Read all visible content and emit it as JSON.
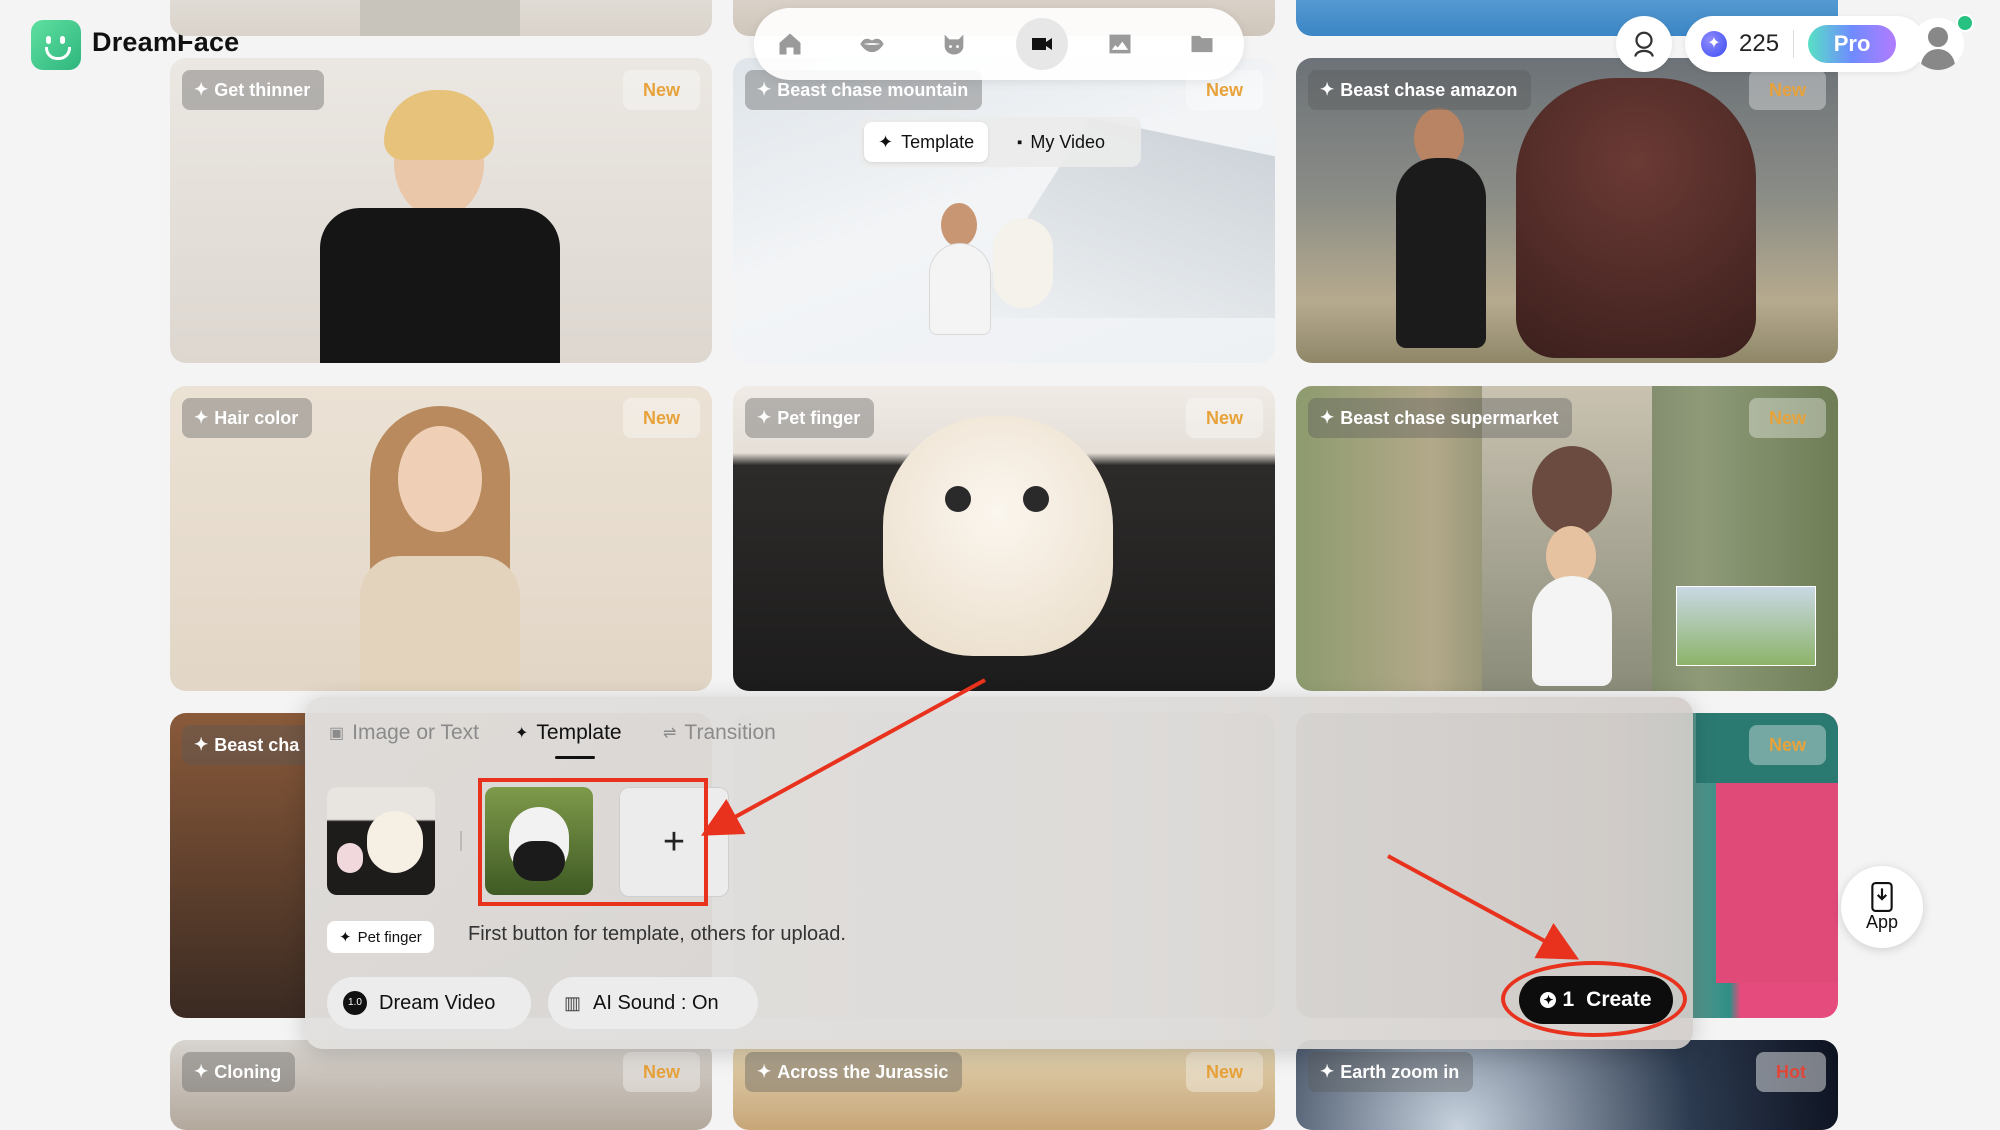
{
  "app": {
    "name": "DreamFace"
  },
  "nav": {
    "items": [
      {
        "id": "home",
        "icon": "home-icon"
      },
      {
        "id": "lips",
        "icon": "lips-icon"
      },
      {
        "id": "pet",
        "icon": "cat-icon"
      },
      {
        "id": "video",
        "icon": "video-camera-icon",
        "active": true
      },
      {
        "id": "image",
        "icon": "image-icon"
      },
      {
        "id": "folder",
        "icon": "folder-icon"
      }
    ]
  },
  "header": {
    "credits": "225",
    "pro_label": "Pro"
  },
  "subtoggle": {
    "template_label": "Template",
    "my_video_label": "My Video"
  },
  "cards": [
    {
      "label": "Get thinner",
      "badge": "New"
    },
    {
      "label": "Beast chase mountain",
      "badge": "New"
    },
    {
      "label": "Beast chase amazon",
      "badge": "New"
    },
    {
      "label": "Hair color",
      "badge": "New"
    },
    {
      "label": "Pet finger",
      "badge": "New"
    },
    {
      "label": "Beast chase supermarket",
      "badge": "New"
    },
    {
      "label": "Beast cha",
      "badge": ""
    },
    {
      "label": "",
      "badge": "New"
    },
    {
      "label": "Cloning",
      "badge": "New"
    },
    {
      "label": "Across the Jurassic",
      "badge": "New"
    },
    {
      "label": "Earth zoom in",
      "badge": "Hot"
    }
  ],
  "panel": {
    "tabs": [
      {
        "label": "Image or Text",
        "icon": "image-icon"
      },
      {
        "label": "Template",
        "icon": "sparkle-icon",
        "active": true
      },
      {
        "label": "Transition",
        "icon": "swap-icon"
      }
    ],
    "template_chip": "Pet finger",
    "hint": "First button for template, others for upload.",
    "add_symbol": "+",
    "model_badge": "1.0",
    "model_label": "Dream Video",
    "sound_label": "AI Sound : On",
    "create_count": "1",
    "create_label": "Create"
  },
  "app_button": {
    "label": "App"
  },
  "colors": {
    "accent_red": "#e8321d",
    "new_badge": "#e8a23a",
    "hot_badge": "#e0473a",
    "brand_green": "#2fb57d"
  }
}
